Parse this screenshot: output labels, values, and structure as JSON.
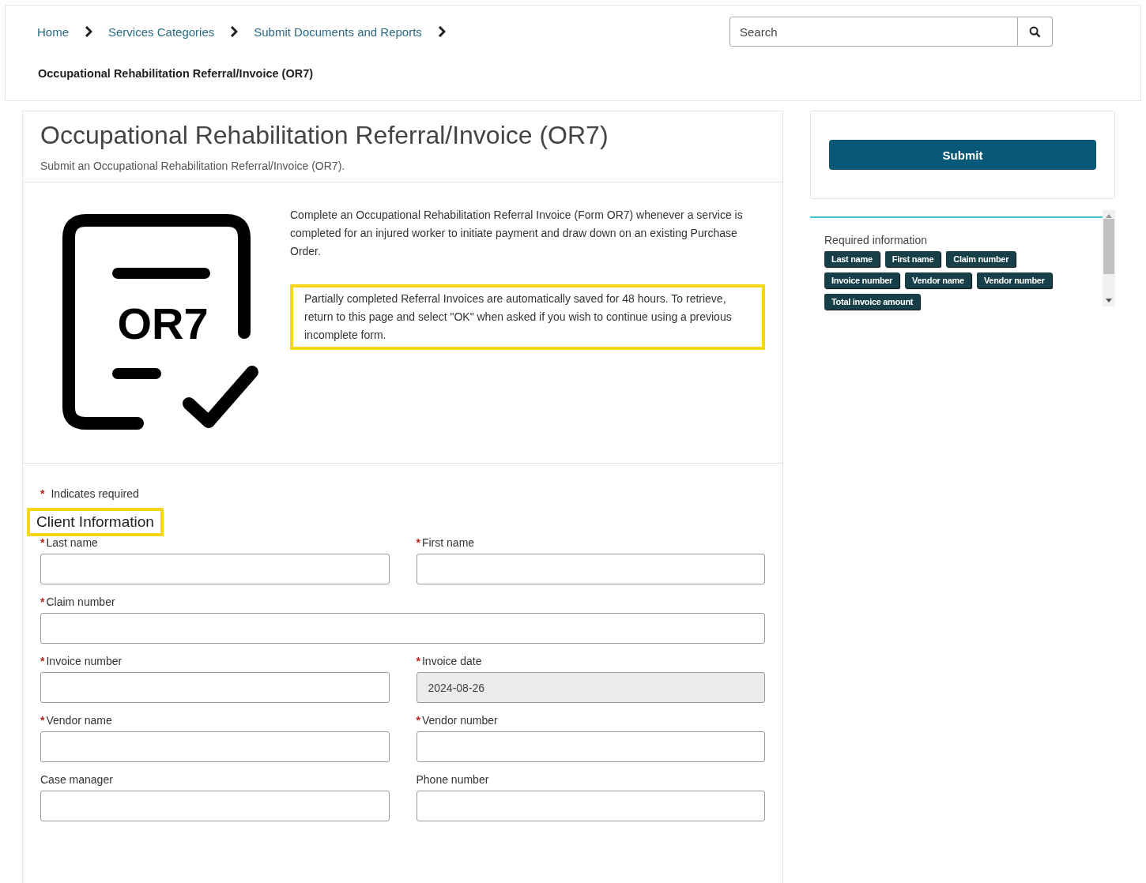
{
  "breadcrumb": [
    {
      "label": "Home"
    },
    {
      "label": "Services Categories"
    },
    {
      "label": "Submit Documents and Reports"
    }
  ],
  "current_page": "Occupational Rehabilitation Referral/Invoice (OR7)",
  "search": {
    "placeholder": "Search"
  },
  "form_header": {
    "title": "Occupational Rehabilitation Referral/Invoice (OR7)",
    "subtitle": "Submit an Occupational Rehabilitation Referral/Invoice (OR7)."
  },
  "form_icon_text": "OR7",
  "intro": "Complete an Occupational Rehabilitation Referral Invoice (Form OR7) whenever a service is completed for an injured worker to initiate payment and draw down on an existing Purchase Order.",
  "notice": {
    "text": "Partially completed Referral Invoices are automatically saved for 48 hours. To retrieve, return to this page and select \"OK\" when asked if you wish to continue using a previous incomplete form.",
    "highlighted": true
  },
  "required_legend": {
    "mark": "*",
    "text": "Indicates required"
  },
  "section": {
    "title": "Client Information",
    "highlighted": true
  },
  "field_rows": [
    [
      {
        "label": "Last name",
        "required": true,
        "disabled": false
      },
      {
        "label": "First name",
        "required": true,
        "disabled": false
      }
    ],
    [
      {
        "label": "Claim number",
        "required": true,
        "disabled": false
      }
    ],
    [
      {
        "label": "Invoice number",
        "required": true,
        "disabled": false
      },
      {
        "label": "Invoice date",
        "required": true,
        "disabled": true,
        "value": "2024-08-26"
      }
    ],
    [
      {
        "label": "Vendor name",
        "required": true,
        "disabled": false
      },
      {
        "label": "Vendor number",
        "required": true,
        "disabled": false
      }
    ],
    [
      {
        "label": "Case manager",
        "required": false,
        "disabled": false
      },
      {
        "label": "Phone number",
        "required": false,
        "disabled": false
      }
    ]
  ],
  "submit_button": "Submit",
  "required_info": {
    "title": "Required information",
    "tags": [
      "Last name",
      "First name",
      "Claim number",
      "Invoice number",
      "Vendor name",
      "Vendor number",
      "Total invoice amount"
    ]
  }
}
